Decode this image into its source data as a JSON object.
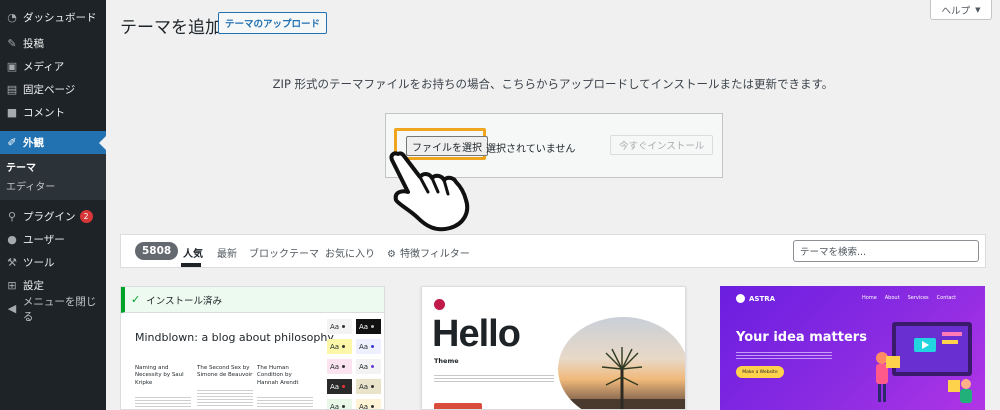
{
  "sidebar": {
    "items": [
      {
        "label": "ダッシュボード",
        "icon": "dashboard-icon"
      },
      {
        "label": "投稿",
        "icon": "pin-icon"
      },
      {
        "label": "メディア",
        "icon": "media-icon"
      },
      {
        "label": "固定ページ",
        "icon": "page-icon"
      },
      {
        "label": "コメント",
        "icon": "comment-icon"
      },
      {
        "label": "外観",
        "icon": "brush-icon",
        "active": true
      },
      {
        "label": "プラグイン",
        "icon": "plugin-icon",
        "badge": "2"
      },
      {
        "label": "ユーザー",
        "icon": "user-icon"
      },
      {
        "label": "ツール",
        "icon": "wrench-icon"
      },
      {
        "label": "設定",
        "icon": "settings-icon"
      },
      {
        "label": "メニューを閉じる",
        "icon": "collapse-icon"
      }
    ],
    "submenu": [
      {
        "label": "テーマ",
        "current": true
      },
      {
        "label": "エディター"
      }
    ]
  },
  "header": {
    "title": "テーマを追加",
    "upload_label": "テーマのアップロード",
    "help_label": "ヘルプ"
  },
  "upload": {
    "intro": "ZIP 形式のテーマファイルをお持ちの場合、こちらからアップロードしてインストールまたは更新できます。",
    "file_button": "ファイルを選択",
    "file_status": "選択されていません",
    "install_button": "今すぐインストール"
  },
  "filter": {
    "count": "5808",
    "tabs": [
      "人気",
      "最新",
      "ブロックテーマ",
      "お気に入り"
    ],
    "feature_filter": "特徴フィルター",
    "search_placeholder": "テーマを検索..."
  },
  "themes": {
    "installed_label": "インストール済み",
    "card1": {
      "title": "Mindblown: a blog about philosophy.",
      "columns": [
        {
          "title": "Naming and Necessity by Saul Kripke"
        },
        {
          "title": "The Second Sex by Simone de Beauvoir"
        },
        {
          "title": "The Human Condition by Hannah Arendt"
        }
      ],
      "swatch_label": "Aa"
    },
    "card2": {
      "heading": "Hello",
      "subheading": "Theme"
    },
    "card3": {
      "brand": "ASTRA",
      "nav": [
        "Home",
        "About",
        "Services",
        "Contact"
      ],
      "headline": "Your idea matters",
      "cta": "Make a Website"
    }
  },
  "colors": {
    "sidebar_bg": "#1d2327",
    "accent": "#2271b1",
    "highlight": "#f0a51e",
    "badge": "#d63638"
  }
}
